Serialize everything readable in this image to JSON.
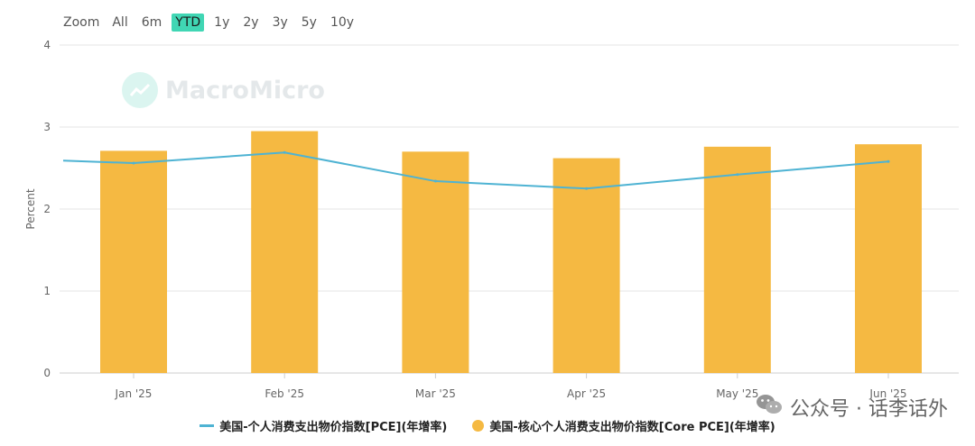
{
  "zoom": {
    "label": "Zoom",
    "options": [
      "All",
      "6m",
      "YTD",
      "1y",
      "2y",
      "3y",
      "5y",
      "10y"
    ],
    "selected": "YTD"
  },
  "watermark": {
    "text": "MacroMicro"
  },
  "wechat": {
    "text": "公众号 · 话李话外",
    "icon": "wechat-icon"
  },
  "colors": {
    "line": "#4eb3d3",
    "bar": "#f5b942",
    "zoom_active": "#40d6b4"
  },
  "chart_data": {
    "type": "bar",
    "categories": [
      "Jan '25",
      "Feb '25",
      "Mar '25",
      "Apr '25",
      "May '25",
      "Jun '25"
    ],
    "ylabel": "Percent",
    "ylim": [
      0,
      4
    ],
    "yticks": [
      0,
      1,
      2,
      3,
      4
    ],
    "grid": true,
    "legend_position": "bottom",
    "series": [
      {
        "name": "美国-个人消费支出物价指数[PCE](年增率)",
        "type": "line",
        "color": "#4eb3d3",
        "values": [
          2.56,
          2.69,
          2.34,
          2.25,
          2.42,
          2.58
        ],
        "start_value": 2.59
      },
      {
        "name": "美国-核心个人消费支出物价指数[Core PCE](年增率)",
        "type": "bar",
        "color": "#f5b942",
        "values": [
          2.71,
          2.95,
          2.7,
          2.62,
          2.76,
          2.79
        ]
      }
    ]
  }
}
